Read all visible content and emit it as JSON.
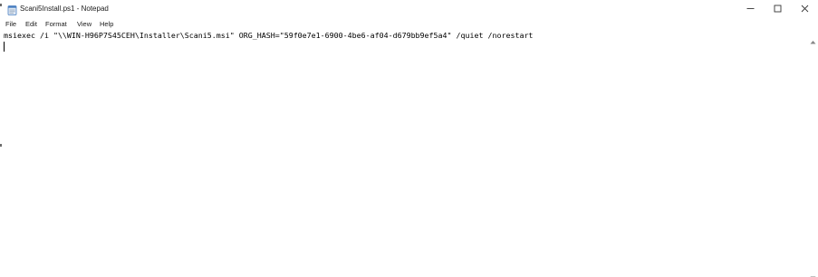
{
  "window": {
    "title": "Scani5Install.ps1 - Notepad",
    "icon": "notepad-icon",
    "controls": {
      "minimize_icon": "minimize-icon",
      "maximize_icon": "maximize-icon",
      "close_icon": "close-icon"
    }
  },
  "menu": {
    "file": "File",
    "edit": "Edit",
    "format": "Format",
    "view": "View",
    "help": "Help"
  },
  "editor": {
    "lines": [
      "msiexec /i \"\\\\WIN-H96P7S45CEH\\Installer\\Scani5.msi\" ORG_HASH=\"59f0e7e1-6900-4be6-af04-d679bb9ef5a4\" /quiet /norestart"
    ]
  },
  "colors": {
    "background": "#ffffff",
    "text": "#000000",
    "chrome_text": "#1a1a1a"
  }
}
